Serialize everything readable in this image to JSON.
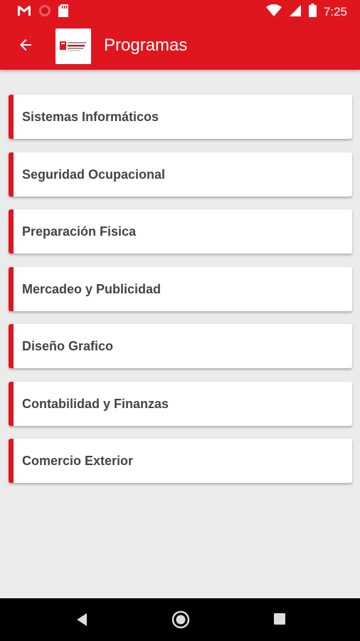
{
  "status_bar": {
    "time": "7:25",
    "icons": [
      "gmail-icon",
      "record-icon",
      "sd-card-icon",
      "wifi-icon",
      "signal-icon",
      "battery-icon"
    ]
  },
  "toolbar": {
    "title": "Programas",
    "back_icon": "arrow-left-icon",
    "logo": "institution-logo",
    "color": "#e0161f"
  },
  "programs": [
    {
      "label": "Sistemas Informáticos"
    },
    {
      "label": "Seguridad Ocupacional"
    },
    {
      "label": "Preparación Fisica"
    },
    {
      "label": "Mercadeo y Publicidad"
    },
    {
      "label": "Diseño Grafico"
    },
    {
      "label": "Contabilidad y Finanzas"
    },
    {
      "label": "Comercio Exterior"
    }
  ],
  "nav_bar": {
    "buttons": [
      "back-triangle-icon",
      "home-circle-icon",
      "recents-square-icon"
    ]
  }
}
